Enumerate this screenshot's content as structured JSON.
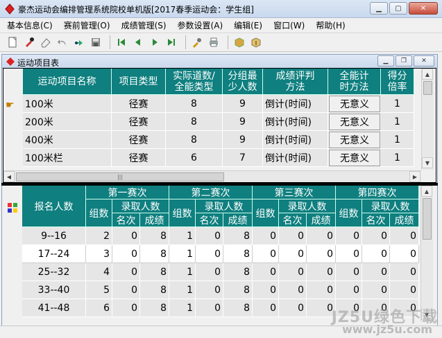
{
  "window": {
    "title": "豪杰运动会编排管理系统院校单机版[2017春季运动会：学生组]"
  },
  "menu": [
    "基本信息(C)",
    "赛前管理(O)",
    "成绩管理(S)",
    "参数设置(A)",
    "编辑(E)",
    "窗口(W)",
    "帮助(H)"
  ],
  "toolbar": [
    "new-icon",
    "pin-icon",
    "eraser-icon",
    "undo-icon",
    "redo-icon",
    "save-icon",
    "first-icon",
    "prev-icon",
    "next-icon",
    "last-icon",
    "filter-icon",
    "print-icon",
    "package-icon",
    "export-icon"
  ],
  "child": {
    "title": "运动项目表"
  },
  "events": {
    "columns": [
      "运动项目名称",
      "项目类型",
      "实际道数/全能类型",
      "分组最少人数",
      "成绩评判方法",
      "全能计时方法",
      "得分倍率"
    ],
    "rows": [
      [
        "100米",
        "径赛",
        "8",
        "9",
        "倒计(时间)",
        "无意义",
        "1"
      ],
      [
        "200米",
        "径赛",
        "8",
        "9",
        "倒计(时间)",
        "无意义",
        "1"
      ],
      [
        "400米",
        "径赛",
        "8",
        "9",
        "倒计(时间)",
        "无意义",
        "1"
      ],
      [
        "100米栏",
        "径赛",
        "6",
        "7",
        "倒计(时间)",
        "无意义",
        "1"
      ]
    ]
  },
  "rounds": {
    "entrants_header": "报名人数",
    "round_names": [
      "第一赛次",
      "第二赛次",
      "第三赛次",
      "第四赛次"
    ],
    "sub": {
      "groups": "组数",
      "qualify": "录取人数",
      "rank": "名次",
      "score": "成绩"
    },
    "rows": [
      [
        "9--16",
        "2",
        "0",
        "8",
        "1",
        "0",
        "8",
        "0",
        "0",
        "0",
        "0",
        "0",
        "0"
      ],
      [
        "17--24",
        "3",
        "0",
        "8",
        "1",
        "0",
        "8",
        "0",
        "0",
        "0",
        "0",
        "0",
        "0"
      ],
      [
        "25--32",
        "4",
        "0",
        "8",
        "1",
        "0",
        "8",
        "0",
        "0",
        "0",
        "0",
        "0",
        "0"
      ],
      [
        "33--40",
        "5",
        "0",
        "8",
        "1",
        "0",
        "8",
        "0",
        "0",
        "0",
        "0",
        "0",
        "0"
      ],
      [
        "41--48",
        "6",
        "0",
        "8",
        "1",
        "0",
        "8",
        "0",
        "0",
        "0",
        "0",
        "0",
        "0"
      ]
    ]
  },
  "watermark": {
    "line1": "JZ5U绿色下载",
    "line2": "www.jz5u.com"
  }
}
